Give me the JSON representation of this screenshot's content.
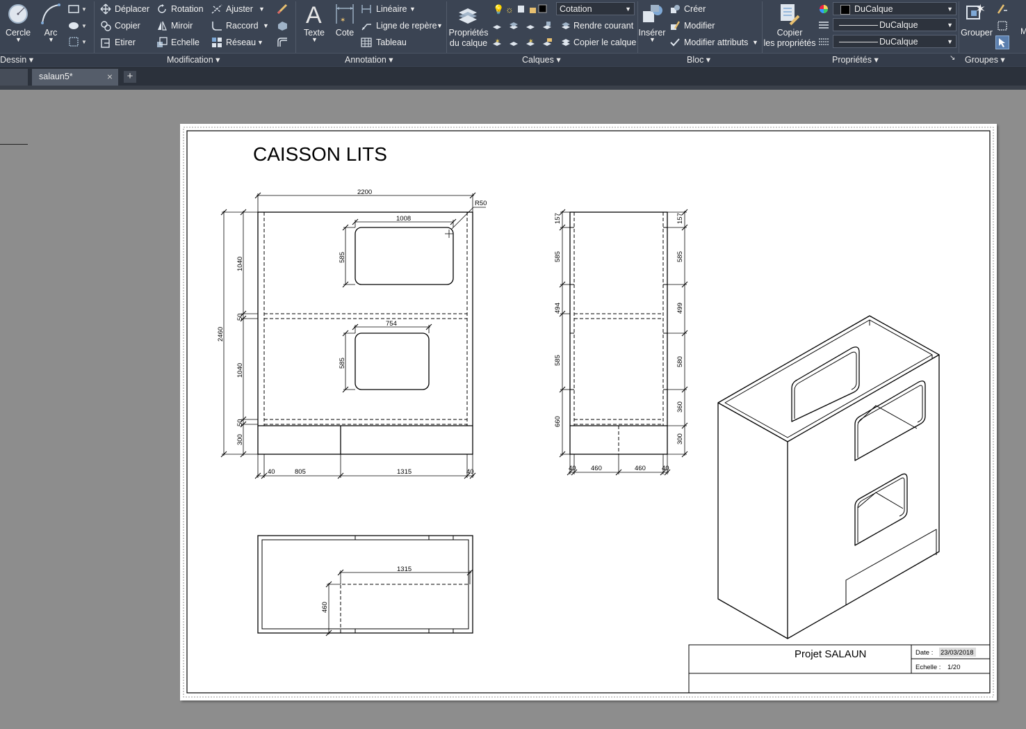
{
  "ribbon": {
    "dessin": {
      "cercle": "Cercle",
      "arc": "Arc"
    },
    "modification": {
      "deplacer": "Déplacer",
      "rotation": "Rotation",
      "ajuster": "Ajuster",
      "copier": "Copier",
      "miroir": "Miroir",
      "raccord": "Raccord",
      "etirer": "Etirer",
      "echelle": "Echelle",
      "reseau": "Réseau"
    },
    "annotation": {
      "texte": "Texte",
      "cote": "Cote",
      "lineaire": "Linéaire",
      "ligne_repere": "Ligne de repère",
      "tableau": "Tableau"
    },
    "calques": {
      "proprietes_l1": "Propriétés",
      "proprietes_l2": "du calque",
      "layer_current": "Cotation",
      "rendre_courant": "Rendre courant",
      "copier_calque": "Copier le calque"
    },
    "bloc": {
      "inserer": "Insérer",
      "creer": "Créer",
      "modifier": "Modifier",
      "modifier_attributs": "Modifier attributs"
    },
    "proprietes": {
      "copier_l1": "Copier",
      "copier_l2": "les propriétés",
      "color": "DuCalque",
      "linetype": "DuCalque",
      "lineweight": "DuCalque"
    },
    "groupes": {
      "grouper": "Grouper"
    },
    "panels": {
      "dessin": "Dessin",
      "modification": "Modification",
      "annotation": "Annotation",
      "calques": "Calques",
      "bloc": "Bloc",
      "proprietes": "Propriétés",
      "groupes": "Groupes"
    }
  },
  "tabs": {
    "active": "salaun5*",
    "close": "×",
    "new": "+"
  },
  "drawing": {
    "title": "CAISSON LITS",
    "front": {
      "width": "2200",
      "r": "R50",
      "w1008": "1008",
      "w754": "754",
      "h585a": "585",
      "h585b": "585",
      "h2460": "2460",
      "h1040a": "1040",
      "h50a": "50",
      "h1040b": "1040",
      "h50b": "50",
      "h300": "300",
      "b40a": "40",
      "b805": "805",
      "b1315": "1315",
      "b40b": "40"
    },
    "side": {
      "l157": "157",
      "l585a": "585",
      "l494": "494",
      "l585b": "585",
      "l660": "660",
      "r157": "157",
      "r585": "585",
      "r499": "499",
      "r580": "580",
      "r360": "360",
      "r300": "300",
      "b40a": "40",
      "b460a": "460",
      "b460b": "460",
      "b40b": "40"
    },
    "top": {
      "w1315": "1315",
      "h460": "460"
    }
  },
  "titleblock": {
    "projet": "Projet SALAUN",
    "date_label": "Date :",
    "date_value": "23/03/2018",
    "echelle_label": "Echelle :",
    "echelle_value": "1/20"
  }
}
